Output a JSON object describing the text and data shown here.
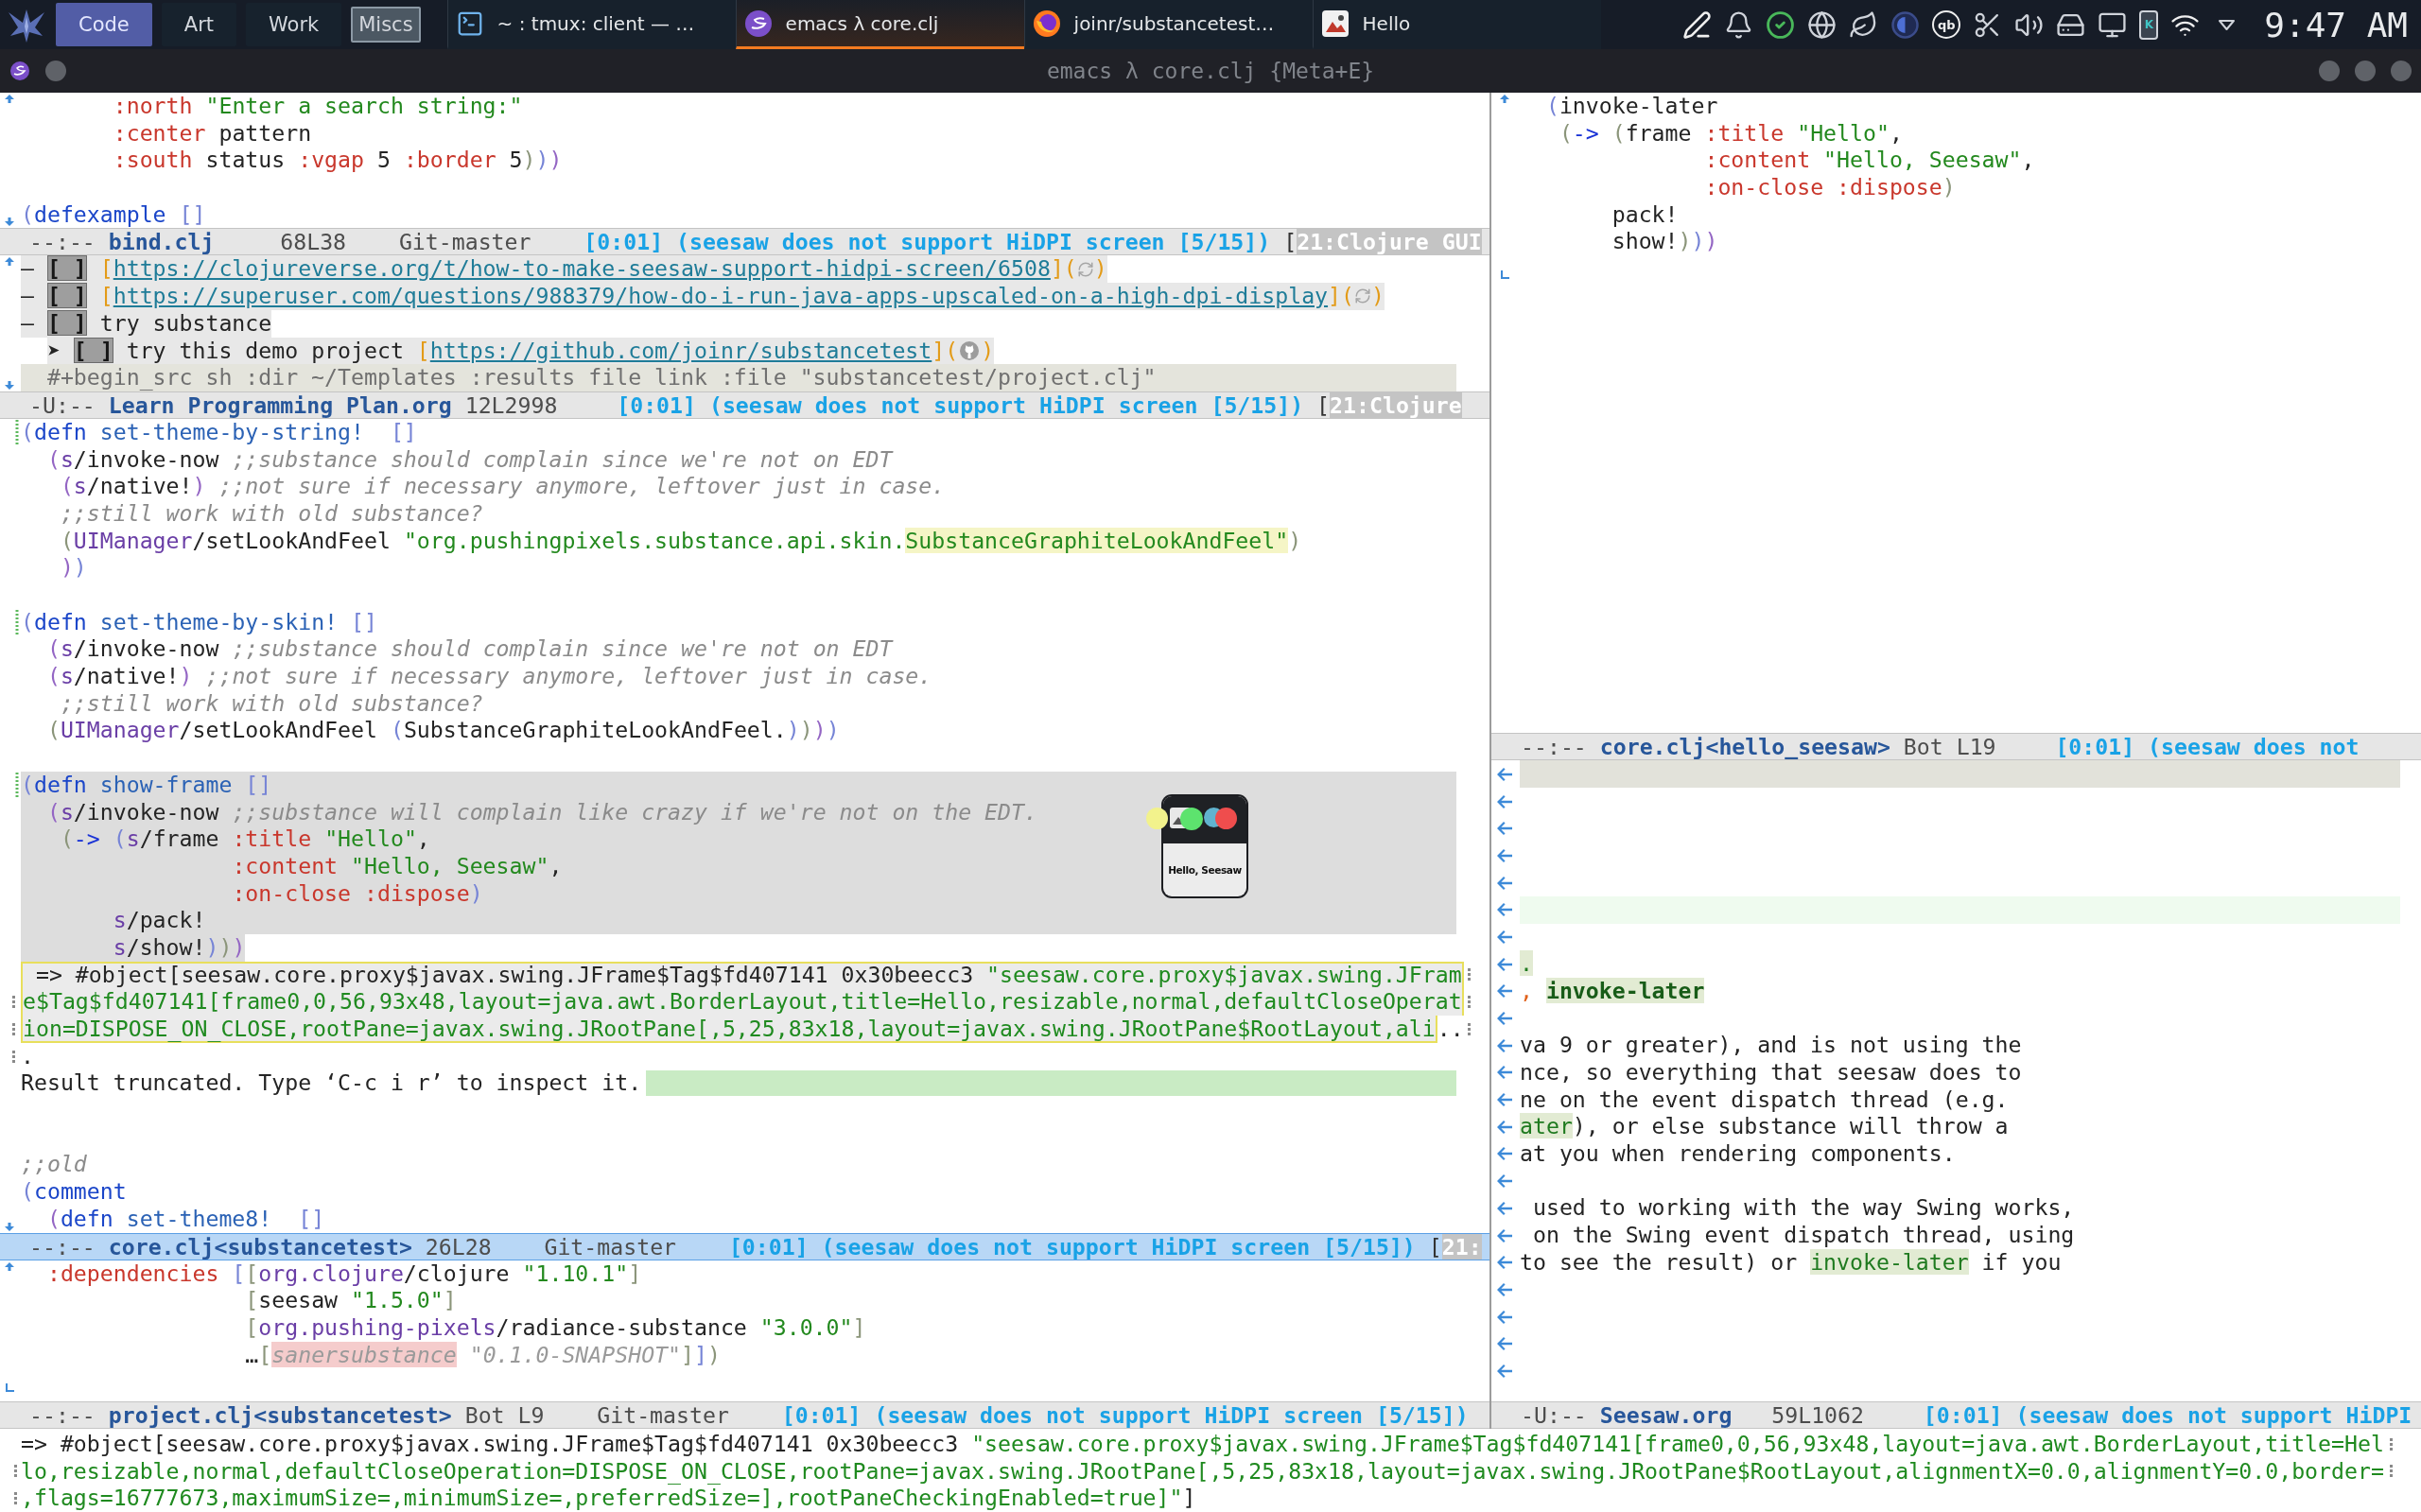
{
  "panel": {
    "workspaces": [
      {
        "label": "Code",
        "selected": true,
        "visible": false
      },
      {
        "label": "Art",
        "selected": false,
        "visible": false
      },
      {
        "label": "Work",
        "selected": false,
        "visible": false
      },
      {
        "label": "Miscs",
        "selected": false,
        "visible": true
      }
    ],
    "tasks": [
      {
        "kind": "terminal",
        "label": "~ : tmux: client — …",
        "selected": false
      },
      {
        "kind": "editor",
        "label": "emacs λ core.clj",
        "selected": true
      },
      {
        "kind": "browser",
        "label": "joinr/substancetest…",
        "selected": false
      },
      {
        "kind": "java",
        "label": "Hello",
        "selected": false
      }
    ],
    "tray": [
      {
        "kind": "pen"
      },
      {
        "kind": "bell"
      },
      {
        "kind": "sync"
      },
      {
        "kind": "globe"
      },
      {
        "kind": "leaf"
      },
      {
        "kind": "toggle"
      },
      {
        "kind": "badge",
        "label": "qb"
      },
      {
        "kind": "scissors"
      },
      {
        "kind": "speaker"
      },
      {
        "kind": "drive"
      },
      {
        "kind": "monitor"
      },
      {
        "kind": "phone",
        "label": "K"
      },
      {
        "kind": "wifi"
      },
      {
        "kind": "caret"
      }
    ],
    "clock": "9:47 AM"
  },
  "titlebar": {
    "title": "emacs λ core.clj {Meta+E}"
  },
  "left_windows": [
    {
      "lines": [
        {
          "kind": "line",
          "fringe": {
            "kind": "top"
          },
          "tokens": [
            {
              "kind": "kw",
              "text": "       :north"
            },
            {
              "kind": "str",
              "text": " \"Enter a search string:\""
            }
          ]
        },
        {
          "kind": "line",
          "tokens": [
            {
              "kind": "kw",
              "text": "       :center"
            },
            {
              "kind": "text",
              "text": " pattern"
            }
          ]
        },
        {
          "kind": "line",
          "tokens": [
            {
              "kind": "kw",
              "text": "       :south"
            },
            {
              "kind": "text",
              "text": " status "
            },
            {
              "kind": "kw",
              "text": ":vgap"
            },
            {
              "kind": "text",
              "text": " 5 "
            },
            {
              "kind": "kw",
              "text": ":border"
            },
            {
              "kind": "text",
              "text": " 5"
            },
            {
              "kind": "delim2",
              "text": ")"
            },
            {
              "kind": "delim",
              "text": ")"
            },
            {
              "kind": "delim3",
              "text": ")"
            }
          ]
        },
        {
          "kind": "line"
        },
        {
          "kind": "line",
          "fringe": {
            "kind": "bottom"
          },
          "tokens": [
            {
              "kind": "delim",
              "text": "("
            },
            {
              "kind": "def",
              "text": "defexample"
            },
            {
              "kind": "delim",
              "text": " []"
            }
          ]
        }
      ],
      "modeline": {
        "active": false,
        "state": "--:--",
        "buffer": "bind.clj",
        "position": "68L38",
        "vc": "Git-master",
        "timer": "[0:01]",
        "task": "(seesaw does not support HiDPI screen [5/15])",
        "bracket": "[",
        "tag": "21:Clojure GUI"
      }
    },
    {
      "lines": [
        {
          "kind": "line",
          "fringe": {
            "kind": "top"
          },
          "band": {
            "kind": "item"
          },
          "tokens": [
            {
              "kind": "text",
              "text": "– "
            },
            {
              "kind": "box",
              "text": "[ ]"
            },
            {
              "kind": "bracket",
              "text": " ["
            },
            {
              "kind": "link",
              "text": "https://clojureverse.org/t/how-to-make-seesaw-support-hidpi-screen/6508"
            },
            {
              "kind": "bracket",
              "text": "]("
            },
            {
              "kind": "sync_mark"
            },
            {
              "kind": "bracket",
              "text": ")"
            }
          ]
        },
        {
          "kind": "line",
          "band": {
            "kind": "item"
          },
          "tokens": [
            {
              "kind": "text",
              "text": "– "
            },
            {
              "kind": "box",
              "text": "[ ]"
            },
            {
              "kind": "bracket",
              "text": " ["
            },
            {
              "kind": "link",
              "text": "https://superuser.com/questions/988379/how-do-i-run-java-apps-upscaled-on-a-high-dpi-display"
            },
            {
              "kind": "bracket",
              "text": "]("
            },
            {
              "kind": "sync_mark"
            },
            {
              "kind": "bracket",
              "text": ")"
            }
          ]
        },
        {
          "kind": "line",
          "band": {
            "kind": "item"
          },
          "tokens": [
            {
              "kind": "text",
              "text": "– "
            },
            {
              "kind": "box",
              "text": "[ ]"
            },
            {
              "kind": "text",
              "text": " try substance"
            }
          ]
        },
        {
          "kind": "line",
          "band": {
            "kind": "item"
          },
          "tokens": [
            {
              "kind": "text",
              "text": "  ➤ "
            },
            {
              "kind": "box",
              "text": "[ ]"
            },
            {
              "kind": "text",
              "text": " try this demo project "
            },
            {
              "kind": "bracket",
              "text": "["
            },
            {
              "kind": "link",
              "text": "https://github.com/joinr/substancetest"
            },
            {
              "kind": "bracket",
              "text": "]("
            },
            {
              "kind": "repo_mark"
            },
            {
              "kind": "bracket",
              "text": ")"
            }
          ]
        },
        {
          "kind": "line",
          "fringe": {
            "kind": "bottom"
          },
          "band": {
            "kind": "src"
          },
          "tokens": [
            {
              "kind": "meta",
              "text": "  #+begin_src sh :dir ~/Templates :results file link :file \"substancetest/project.clj\""
            }
          ]
        }
      ],
      "modeline": {
        "active": false,
        "state": "-U:--",
        "buffer": "Learn Programming Plan.org",
        "position": "12L2998",
        "timer": "[0:01]",
        "task": "(seesaw does not support HiDPI screen [5/15])",
        "bracket": "[",
        "tag": "21:Clojure"
      }
    },
    {
      "popup": {
        "label": "Hello, Seesaw"
      },
      "lines": [
        {
          "kind": "line",
          "fringe": {
            "kind": "added"
          },
          "tokens": [
            {
              "kind": "delim",
              "text": "("
            },
            {
              "kind": "def",
              "text": "defn"
            },
            {
              "kind": "name",
              "text": " set-theme-by-string!"
            },
            {
              "kind": "delim",
              "text": "  []"
            }
          ]
        },
        {
          "kind": "line",
          "tokens": [
            {
              "kind": "delim3",
              "text": "  ("
            },
            {
              "kind": "ns",
              "text": "s"
            },
            {
              "kind": "text",
              "text": "/invoke-now "
            },
            {
              "kind": "cmt",
              "text": ";;substance should complain since we're not on EDT"
            }
          ]
        },
        {
          "kind": "line",
          "tokens": [
            {
              "kind": "delim3",
              "text": "   ("
            },
            {
              "kind": "ns",
              "text": "s"
            },
            {
              "kind": "text",
              "text": "/native!"
            },
            {
              "kind": "delim3",
              "text": ")"
            },
            {
              "kind": "cmt",
              "text": " ;;not sure if necessary anymore, leftover just in case."
            }
          ]
        },
        {
          "kind": "line",
          "tokens": [
            {
              "kind": "cmt",
              "text": "   ;;still work with old substance?"
            }
          ]
        },
        {
          "kind": "line",
          "tokens": [
            {
              "kind": "delim2",
              "text": "   ("
            },
            {
              "kind": "ns",
              "text": "UIManager"
            },
            {
              "kind": "text",
              "text": "/setLookAndFeel "
            },
            {
              "kind": "str",
              "text": "\"org.pushingpixels.substance.api.skin."
            },
            {
              "kind": "hl",
              "text": "SubstanceGraphiteLookAndFeel\""
            },
            {
              "kind": "delim2",
              "text": ")"
            }
          ]
        },
        {
          "kind": "line",
          "tokens": [
            {
              "kind": "delim3",
              "text": "   )"
            },
            {
              "kind": "delim",
              "text": ")"
            }
          ]
        },
        {
          "kind": "line"
        },
        {
          "kind": "line",
          "fringe": {
            "kind": "added"
          },
          "tokens": [
            {
              "kind": "delim",
              "text": "("
            },
            {
              "kind": "def",
              "text": "defn"
            },
            {
              "kind": "name",
              "text": " set-theme-by-skin!"
            },
            {
              "kind": "delim",
              "text": " []"
            }
          ]
        },
        {
          "kind": "line",
          "tokens": [
            {
              "kind": "delim3",
              "text": "  ("
            },
            {
              "kind": "ns",
              "text": "s"
            },
            {
              "kind": "text",
              "text": "/invoke-now "
            },
            {
              "kind": "cmt",
              "text": ";;substance should complain since we're not on EDT"
            }
          ]
        },
        {
          "kind": "line",
          "tokens": [
            {
              "kind": "delim3",
              "text": "  ("
            },
            {
              "kind": "ns",
              "text": "s"
            },
            {
              "kind": "text",
              "text": "/native!"
            },
            {
              "kind": "delim3",
              "text": ")"
            },
            {
              "kind": "cmt",
              "text": " ;;not sure if necessary anymore, leftover just in case."
            }
          ]
        },
        {
          "kind": "line",
          "tokens": [
            {
              "kind": "cmt",
              "text": "   ;;still work with old substance?"
            }
          ]
        },
        {
          "kind": "line",
          "tokens": [
            {
              "kind": "delim2",
              "text": "  ("
            },
            {
              "kind": "ns",
              "text": "UIManager"
            },
            {
              "kind": "text",
              "text": "/setLookAndFeel "
            },
            {
              "kind": "delim",
              "text": "("
            },
            {
              "kind": "text",
              "text": "SubstanceGraphiteLookAndFeel."
            },
            {
              "kind": "delim",
              "text": ")"
            },
            {
              "kind": "delim2",
              "text": ")"
            },
            {
              "kind": "delim3",
              "text": ")"
            },
            {
              "kind": "delim",
              "text": ")"
            }
          ]
        },
        {
          "kind": "line"
        },
        {
          "kind": "line",
          "fringe": {
            "kind": "added"
          },
          "band": {
            "kind": "region"
          },
          "tokens": [
            {
              "kind": "delim",
              "text": "("
            },
            {
              "kind": "def",
              "text": "defn"
            },
            {
              "kind": "name",
              "text": " show-frame"
            },
            {
              "kind": "delim",
              "text": " []"
            }
          ]
        },
        {
          "kind": "line",
          "band": {
            "kind": "region"
          },
          "tokens": [
            {
              "kind": "delim3",
              "text": "  ("
            },
            {
              "kind": "ns",
              "text": "s"
            },
            {
              "kind": "text",
              "text": "/invoke-now "
            },
            {
              "kind": "cmt",
              "text": ";;substance will complain like crazy if we're not on the EDT."
            }
          ]
        },
        {
          "kind": "line",
          "band": {
            "kind": "region"
          },
          "tokens": [
            {
              "kind": "delim2",
              "text": "   ("
            },
            {
              "kind": "arrow",
              "text": "->"
            },
            {
              "kind": "delim",
              "text": " ("
            },
            {
              "kind": "ns",
              "text": "s"
            },
            {
              "kind": "text",
              "text": "/frame "
            },
            {
              "kind": "kw",
              "text": ":title"
            },
            {
              "kind": "str",
              "text": " \"Hello\""
            },
            {
              "kind": "text",
              "text": ","
            }
          ]
        },
        {
          "kind": "line",
          "band": {
            "kind": "region"
          },
          "tokens": [
            {
              "kind": "kw",
              "text": "                :content"
            },
            {
              "kind": "str",
              "text": " \"Hello, Seesaw\""
            },
            {
              "kind": "text",
              "text": ","
            }
          ]
        },
        {
          "kind": "line",
          "band": {
            "kind": "region"
          },
          "tokens": [
            {
              "kind": "kw",
              "text": "                :on-close :dispose"
            },
            {
              "kind": "delim",
              "text": ")"
            }
          ]
        },
        {
          "kind": "line",
          "band": {
            "kind": "region"
          },
          "tokens": [
            {
              "kind": "ns",
              "text": "       s"
            },
            {
              "kind": "text",
              "text": "/pack!"
            }
          ]
        },
        {
          "kind": "line",
          "band": {
            "kind": "partial"
          },
          "tokens": [
            {
              "kind": "ns",
              "text": "       s"
            },
            {
              "kind": "text",
              "text": "/show!"
            },
            {
              "kind": "delim",
              "text": ")"
            },
            {
              "kind": "delim2",
              "text": ")"
            },
            {
              "kind": "delim3",
              "text": ")"
            }
          ]
        },
        {
          "kind": "result",
          "lines": [
            {
              "wrapped": true,
              "tokens": [
                {
                  "kind": "text",
                  "text": " => #object[seesaw.core.proxy$javax.swing.JFrame$Tag$fd407141 0x30beecc3 "
                },
                {
                  "kind": "result",
                  "text": "\"seesaw.core.proxy$javax.swing.JFram"
                }
              ]
            },
            {
              "fringe": {
                "kind": "wrap"
              },
              "wrapped": true,
              "tokens": [
                {
                  "kind": "result",
                  "text": "e$Tag$fd407141[frame0,0,56,93x48,layout=java.awt.BorderLayout,title=Hello,resizable,normal,defaultCloseOperat"
                }
              ]
            },
            {
              "fringe": {
                "kind": "wrap"
              },
              "wrapped": true,
              "tokens": [
                {
                  "kind": "result",
                  "text": "ion=DISPOSE_ON_CLOSE,rootPane=javax.swing.JRootPane[,5,25,83x18,layout=javax.swing.JRootPane$RootLayout,ali"
                }
              ],
              "trailing": [
                {
                  "kind": "text",
                  "text": ".."
                }
              ]
            }
          ]
        },
        {
          "kind": "line",
          "fringe": {
            "kind": "wrap"
          },
          "tokens": [
            {
              "kind": "text",
              "text": "."
            }
          ]
        },
        {
          "kind": "line",
          "band": {
            "kind": "tail"
          },
          "tokens": [
            {
              "kind": "text",
              "text": "Result truncated. Type ‘C-c i r’ to inspect it."
            }
          ]
        },
        {
          "kind": "line"
        },
        {
          "kind": "line"
        },
        {
          "kind": "line",
          "tokens": [
            {
              "kind": "cmt",
              "text": ";;old"
            }
          ]
        },
        {
          "kind": "line",
          "tokens": [
            {
              "kind": "delim",
              "text": "("
            },
            {
              "kind": "def",
              "text": "comment"
            }
          ]
        },
        {
          "kind": "line",
          "fringe": {
            "kind": "bottom"
          },
          "tokens": [
            {
              "kind": "delim3",
              "text": "  ("
            },
            {
              "kind": "def",
              "text": "defn"
            },
            {
              "kind": "name",
              "text": " set-theme8!"
            },
            {
              "kind": "delim",
              "text": "  []"
            }
          ]
        }
      ],
      "modeline": {
        "active": true,
        "state": "--:--",
        "buffer": "core.clj<substancetest>",
        "position": "26L28",
        "vc": "Git-master",
        "timer": "[0:01]",
        "task": "(seesaw does not support HiDPI screen [5/15])",
        "bracket": "[",
        "tag": "21:"
      }
    },
    {
      "lines": [
        {
          "kind": "line",
          "fringe": {
            "kind": "top"
          },
          "tokens": [
            {
              "kind": "kw",
              "text": "  :dependencies"
            },
            {
              "kind": "delim",
              "text": " ["
            },
            {
              "kind": "delim2",
              "text": "["
            },
            {
              "kind": "ns",
              "text": "org.clojure"
            },
            {
              "kind": "text",
              "text": "/clojure "
            },
            {
              "kind": "str",
              "text": "\"1.10.1\""
            },
            {
              "kind": "delim2",
              "text": "]"
            }
          ]
        },
        {
          "kind": "line",
          "tokens": [
            {
              "kind": "delim2",
              "text": "                 ["
            },
            {
              "kind": "text",
              "text": "seesaw "
            },
            {
              "kind": "str",
              "text": "\"1.5.0\""
            },
            {
              "kind": "delim2",
              "text": "]"
            }
          ]
        },
        {
          "kind": "line",
          "tokens": [
            {
              "kind": "delim2",
              "text": "                 ["
            },
            {
              "kind": "ns",
              "text": "org.pushing-pixels"
            },
            {
              "kind": "text",
              "text": "/radiance-substance "
            },
            {
              "kind": "str",
              "text": "\"3.0.0\""
            },
            {
              "kind": "delim2",
              "text": "]"
            }
          ]
        },
        {
          "kind": "line",
          "tokens": [
            {
              "kind": "text",
              "text": "                 …"
            },
            {
              "kind": "delim2",
              "text": "["
            },
            {
              "kind": "flag",
              "text": "sanersubstance"
            },
            {
              "kind": "muted",
              "text": " \"0.1.0-SNAPSHOT\""
            },
            {
              "kind": "delim2",
              "text": "]"
            },
            {
              "kind": "delim",
              "text": "]"
            },
            {
              "kind": "delim2",
              "text": ")"
            }
          ]
        },
        {
          "kind": "line",
          "fringe": {
            "kind": "end"
          }
        }
      ],
      "modeline": {
        "active": false,
        "state": "--:--",
        "buffer": "project.clj<substancetest>",
        "position": "Bot L9",
        "vc": "Git-master",
        "timer": "[0:01]",
        "task": "(seesaw does not support HiDPI screen [5/15])"
      }
    }
  ],
  "right_windows": [
    {
      "lines": [
        {
          "kind": "line",
          "fringe": {
            "kind": "top"
          },
          "tokens": [
            {
              "kind": "delim",
              "text": "  ("
            },
            {
              "kind": "text",
              "text": "invoke-later"
            }
          ]
        },
        {
          "kind": "line",
          "tokens": [
            {
              "kind": "delim2",
              "text": "   ("
            },
            {
              "kind": "arrow",
              "text": "->"
            },
            {
              "kind": "delim2",
              "text": " ("
            },
            {
              "kind": "text",
              "text": "frame "
            },
            {
              "kind": "kw",
              "text": ":title"
            },
            {
              "kind": "str",
              "text": " \"Hello\""
            },
            {
              "kind": "text",
              "text": ","
            }
          ]
        },
        {
          "kind": "line",
          "tokens": [
            {
              "kind": "kw",
              "text": "              :content"
            },
            {
              "kind": "str",
              "text": " \"Hello, Seesaw\""
            },
            {
              "kind": "text",
              "text": ","
            }
          ]
        },
        {
          "kind": "line",
          "tokens": [
            {
              "kind": "kw",
              "text": "              :on-close :dispose"
            },
            {
              "kind": "delim2",
              "text": ")"
            }
          ]
        },
        {
          "kind": "line",
          "tokens": [
            {
              "kind": "text",
              "text": "       pack!"
            }
          ]
        },
        {
          "kind": "line",
          "tokens": [
            {
              "kind": "text",
              "text": "       show!"
            },
            {
              "kind": "delim2",
              "text": ")"
            },
            {
              "kind": "delim",
              "text": ")"
            },
            {
              "kind": "delim3",
              "text": ")"
            }
          ]
        },
        {
          "kind": "line",
          "fringe": {
            "kind": "end"
          }
        }
      ],
      "modeline": {
        "active": false,
        "state": "--:--",
        "buffer": "core.clj<hello_seesaw>",
        "position": "Bot L19",
        "timer": "[0:01]",
        "task": "(seesaw does not"
      }
    },
    {
      "lines": [
        {
          "kind": "line",
          "fringe": {
            "kind": "left"
          },
          "band": {
            "kind": "current"
          }
        },
        {
          "kind": "line",
          "fringe": {
            "kind": "left"
          }
        },
        {
          "kind": "line",
          "fringe": {
            "kind": "left"
          }
        },
        {
          "kind": "line",
          "fringe": {
            "kind": "left"
          }
        },
        {
          "kind": "line",
          "fringe": {
            "kind": "left"
          }
        },
        {
          "kind": "line",
          "fringe": {
            "kind": "left"
          },
          "band": {
            "kind": "mint"
          }
        },
        {
          "kind": "line",
          "fringe": {
            "kind": "left"
          }
        },
        {
          "kind": "line",
          "fringe": {
            "kind": "left"
          },
          "tokens": [
            {
              "kind": "mark",
              "text": "."
            }
          ]
        },
        {
          "kind": "line",
          "fringe": {
            "kind": "left"
          },
          "tokens": [
            {
              "kind": "punct",
              "text": ", "
            },
            {
              "kind": "strong",
              "text": "invoke-later"
            }
          ]
        },
        {
          "kind": "line",
          "fringe": {
            "kind": "left"
          }
        },
        {
          "kind": "line",
          "fringe": {
            "kind": "left"
          },
          "tokens": [
            {
              "kind": "text",
              "text": "va 9 or greater), and is not using the"
            }
          ]
        },
        {
          "kind": "line",
          "fringe": {
            "kind": "left"
          },
          "tokens": [
            {
              "kind": "text",
              "text": "nce, so everything that seesaw does to"
            }
          ]
        },
        {
          "kind": "line",
          "fringe": {
            "kind": "left"
          },
          "tokens": [
            {
              "kind": "text",
              "text": "ne on the event dispatch thread (e.g."
            }
          ]
        },
        {
          "kind": "line",
          "fringe": {
            "kind": "left"
          },
          "tokens": [
            {
              "kind": "mark",
              "text": "ater"
            },
            {
              "kind": "text",
              "text": "), or else substance will throw a"
            }
          ]
        },
        {
          "kind": "line",
          "fringe": {
            "kind": "left"
          },
          "tokens": [
            {
              "kind": "text",
              "text": "at you when rendering components."
            }
          ]
        },
        {
          "kind": "line",
          "fringe": {
            "kind": "left"
          }
        },
        {
          "kind": "line",
          "fringe": {
            "kind": "left"
          },
          "tokens": [
            {
              "kind": "text",
              "text": " used to working with the way Swing works,"
            }
          ]
        },
        {
          "kind": "line",
          "fringe": {
            "kind": "left"
          },
          "tokens": [
            {
              "kind": "text",
              "text": " on the Swing event dispatch thread, using"
            }
          ]
        },
        {
          "kind": "line",
          "fringe": {
            "kind": "left"
          },
          "tokens": [
            {
              "kind": "text",
              "text": "to see the result) or "
            },
            {
              "kind": "mark",
              "text": "invoke-later"
            },
            {
              "kind": "text",
              "text": " if you"
            }
          ]
        },
        {
          "kind": "line",
          "fringe": {
            "kind": "left"
          }
        },
        {
          "kind": "line",
          "fringe": {
            "kind": "left"
          }
        },
        {
          "kind": "line",
          "fringe": {
            "kind": "left"
          }
        },
        {
          "kind": "line",
          "fringe": {
            "kind": "left"
          }
        }
      ],
      "modeline": {
        "active": false,
        "state": "-U:--",
        "buffer": "Seesaw.org",
        "position": "59L1062",
        "timer": "[0:01]",
        "task": "(seesaw does not support HiDPI"
      }
    }
  ],
  "echo_area": {
    "lines": [
      {
        "continued": false,
        "wrapped": true,
        "tokens": [
          {
            "kind": "text",
            "text": "=> #object[seesaw.core.proxy$javax.swing.JFrame$Tag$fd407141 0x30beecc3 "
          },
          {
            "kind": "result",
            "text": "\"seesaw.core.proxy$javax.swing.JFrame$Tag$fd407141[frame0,0,56,93x48,layout=java.awt.BorderLayout,title=Hel"
          }
        ]
      },
      {
        "continued": true,
        "wrapped": true,
        "tokens": [
          {
            "kind": "result",
            "text": "lo,resizable,normal,defaultCloseOperation=DISPOSE_ON_CLOSE,rootPane=javax.swing.JRootPane[,5,25,83x18,layout=javax.swing.JRootPane$RootLayout,alignmentX=0.0,alignmentY=0.0,border="
          }
        ]
      },
      {
        "continued": true,
        "wrapped": false,
        "tokens": [
          {
            "kind": "result",
            "text": ",flags=16777673,maximumSize=,minimumSize=,preferredSize=],rootPaneCheckingEnabled=true]\""
          },
          {
            "kind": "text",
            "text": "]"
          }
        ]
      }
    ]
  }
}
